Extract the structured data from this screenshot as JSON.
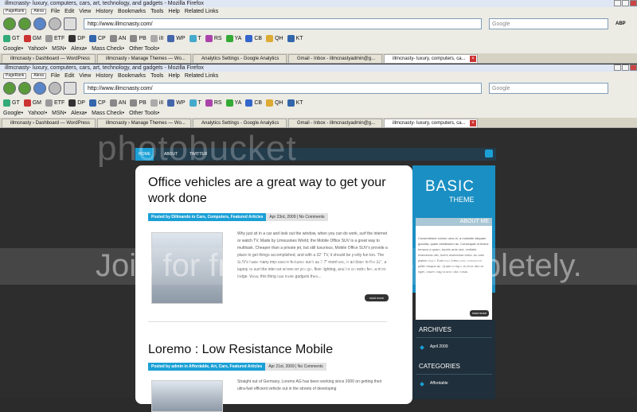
{
  "browser": {
    "window_title": "illmcnasty- luxury, computers, cars, art, technology, and gadgets - Mozilla Firefox",
    "menu_items": [
      "File",
      "Edit",
      "View",
      "History",
      "Bookmarks",
      "Tools",
      "Help",
      "Related Links"
    ],
    "pagerank_label": "PageRank",
    "alexa_label": "Alexa",
    "url": "http://www.illmcnasty.com/",
    "search_placeholder": "Google",
    "abp_label": "ABP",
    "toolbar_items": [
      "GT",
      "GM",
      "ETF",
      "DP",
      "CP",
      "AN",
      "PB",
      "iII",
      "WP",
      "T",
      "RS",
      "YA",
      "CB",
      "QH",
      "KT"
    ],
    "bookmarks": [
      "Google•",
      "Yahoo!•",
      "MSN•",
      "Alexa•",
      "Mass Check•",
      "Other Tools•"
    ],
    "tabs": [
      "illmcnasty › Dashboard — WordPress",
      "illmcnasty › Manage Themes — Wo...",
      "Analytics Settings - Google Analytics",
      "Gmail - Inbox - illmcnastyadmin@g...",
      "illmcnasty- luxury, computers, ca..."
    ]
  },
  "site": {
    "nav": [
      "HOME",
      "ABOUT",
      "TWITTER"
    ],
    "logo_title": "BASIC",
    "logo_sub": "THEME",
    "about_heading": "ABOUT ME",
    "about_text": "Consectetuer rutrum urna in, a molestie aliquam gravida, quam vestibulum ac. Consequat ut lectus tempus a quam, iaculis ante sed, veritatis maecenas nisi, lorem maecenas tortor. Ac odio platea etiam. Euismod libero proin accumsan pellentesque ac. Quam semper in vitae dictum eget, ipsum magna orci odio lectus.",
    "about_more": "read more",
    "archives_heading": "ARCHIVES",
    "archives_item": "April 2009",
    "categories_heading": "CATEGORIES",
    "categories_item": "Affordable"
  },
  "posts": [
    {
      "title": "Office vehicles are a great way to get your work done",
      "meta": "Posted by Dillmando in Cars, Computers, Featured Articles",
      "date": "Apr 23rd, 2009 | No Comments",
      "excerpt": "Why just sit in a car and look out the window, when you can do work, surf the internet or watch TV. Made by Limousines World, the Mobile Office SUV is a great way to multitask. Cheaper than a private jet, but still luxurious, Mobile Office SUV’s provide a place to get things accomplished, and with a 32” TV, it should be pretty fun too. The SUV’s have many impressive features such as 2 7” monitors, in addition to the 32”, a laptop to surf the internet wherever you go, floor lighting, and for an extra fee, a mini-fridge. Wow, this thing has more gadgets then...",
      "readmore": "read more"
    },
    {
      "title": "Loremo : Low Resistance Mobile",
      "meta": "Posted by admin in Affordable, Art, Cars, Featured Articles",
      "date": "Apr 21st, 2009 | No Comments",
      "excerpt": "Straight out of Germany, Loremo AG has been working since 2000 on getting their ultra-fuel efficient vehicle out in the streets of developing"
    }
  ],
  "watermark": {
    "brand": "photobucket",
    "banner": "Join for free and share completely."
  }
}
